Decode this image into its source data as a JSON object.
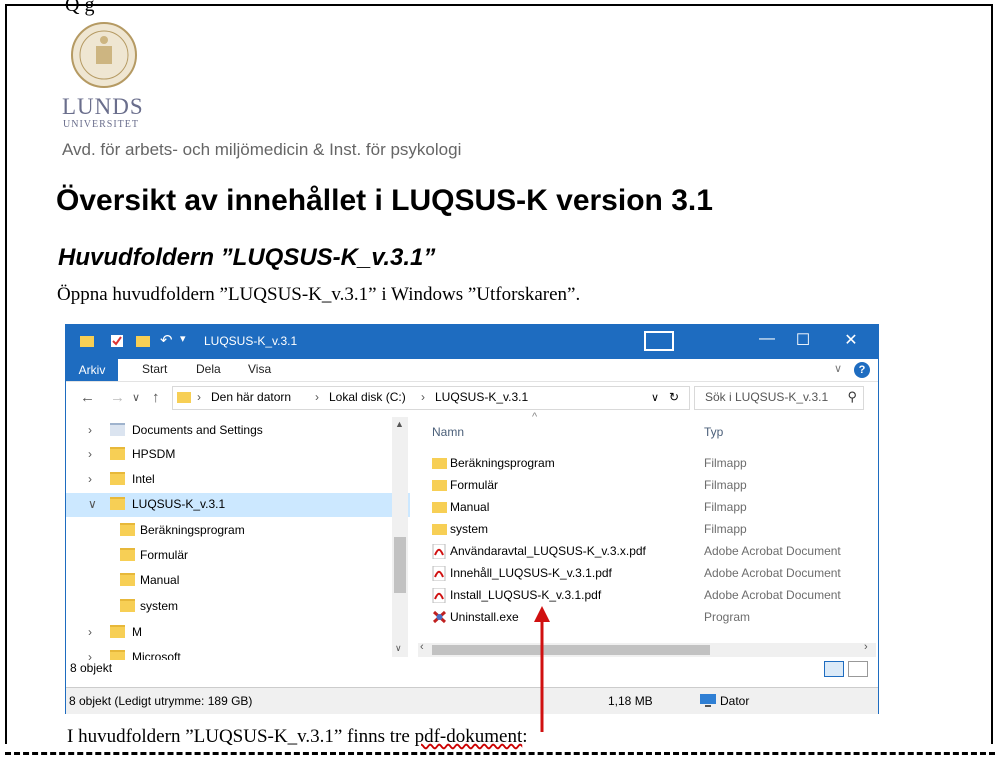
{
  "document": {
    "cutoff_text": "Q      g",
    "logo": {
      "wordmark": "LUNDS",
      "sub": "UNIVERSITET"
    },
    "department": "Avd. för arbets- och miljömedicin & Inst. för psykologi",
    "heading1": "Översikt av innehållet i LUQSUS-K version 3.1",
    "heading2": "Huvudfoldern ”LUQSUS-K_v.3.1”",
    "para1": "Öppna huvudfoldern ”LUQSUS-K_v.3.1” i Windows ”Utforskaren”.",
    "para2_prefix": "I huvudfoldern ”LUQSUS-K_v.3.1” finns tre ",
    "para2_flagged": "pdf-dokument",
    "para2_suffix": ":"
  },
  "explorer": {
    "title": "LUQSUS-K_v.3.1",
    "window_buttons": {
      "minimize": "—",
      "maximize": "☐",
      "close": "✕"
    },
    "ribbon_tabs": [
      "Arkiv",
      "Start",
      "Dela",
      "Visa"
    ],
    "address": {
      "crumbs": [
        "Den här datorn",
        "Lokal disk (C:)",
        "LUQSUS-K_v.3.1"
      ]
    },
    "search_placeholder": "Sök i LUQSUS-K_v.3.1",
    "tree": [
      {
        "label": "Documents and Settings"
      },
      {
        "label": "HPSDM"
      },
      {
        "label": "Intel"
      },
      {
        "label": "LUQSUS-K_v.3.1"
      },
      {
        "label": "Beräkningsprogram"
      },
      {
        "label": "Formulär"
      },
      {
        "label": "Manual"
      },
      {
        "label": "system"
      },
      {
        "label": "M"
      },
      {
        "label": "Microsoft"
      }
    ],
    "columns": {
      "name": "Namn",
      "type": "Typ"
    },
    "files": [
      {
        "name": "Beräkningsprogram",
        "type": "Filmapp",
        "icon": "folder-icon"
      },
      {
        "name": "Formulär",
        "type": "Filmapp",
        "icon": "folder-icon"
      },
      {
        "name": "Manual",
        "type": "Filmapp",
        "icon": "folder-icon"
      },
      {
        "name": "system",
        "type": "Filmapp",
        "icon": "folder-icon"
      },
      {
        "name": "Användaravtal_LUQSUS-K_v.3.x.pdf",
        "type": "Adobe Acrobat Document",
        "icon": "pdf-icon"
      },
      {
        "name": "Innehåll_LUQSUS-K_v.3.1.pdf",
        "type": "Adobe Acrobat Document",
        "icon": "pdf-icon"
      },
      {
        "name": "Install_LUQSUS-K_v.3.1.pdf",
        "type": "Adobe Acrobat Document",
        "icon": "pdf-icon"
      },
      {
        "name": "Uninstall.exe",
        "type": "Program",
        "icon": "uninstall-icon"
      }
    ],
    "item_count": "8 objekt",
    "status": {
      "left": "8 objekt (Ledigt utrymme: 189 GB)",
      "size": "1,18 MB",
      "location": "Dator"
    },
    "accent_color": "#1e6cc0",
    "annotation_color": "#d01010"
  }
}
